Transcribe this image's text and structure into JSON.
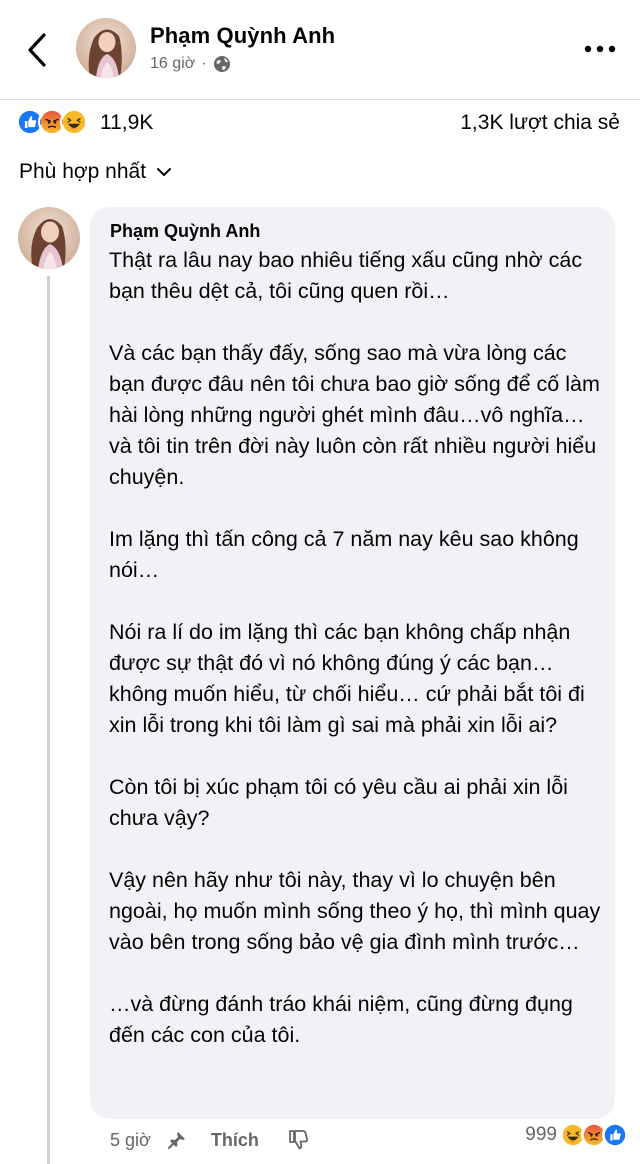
{
  "header": {
    "author": "Phạm Quỳnh Anh",
    "time": "16 giờ",
    "separator": "·",
    "privacy_icon": "globe-icon",
    "back_icon": "chevron-left-icon",
    "more_icon": "more-horizontal-icon"
  },
  "post_stats": {
    "reaction_icons": [
      "like-icon",
      "angry-icon",
      "haha-icon"
    ],
    "reaction_count": "11,9K",
    "share_count": "1,3K lượt chia sẻ"
  },
  "sort": {
    "label": "Phù hợp nhất",
    "icon": "chevron-down-icon"
  },
  "comment": {
    "author": "Phạm Quỳnh Anh",
    "paragraphs": [
      "Thật ra lâu nay bao nhiêu tiếng xấu cũng nhờ các bạn thêu dệt cả, tôi cũng quen rồi…",
      "Và các bạn thấy đấy, sống sao mà vừa lòng các bạn được đâu nên tôi chưa bao giờ sống để cố làm hài lòng những người ghét mình đâu…vô nghĩa… và tôi tin trên đời này luôn còn rất nhiều người hiểu chuyện.",
      "Im lặng thì tấn công cả 7 năm nay kêu sao không nói…",
      "Nói ra lí do im lặng thì các bạn không chấp nhận được sự thật đó vì nó không đúng ý các bạn… không muốn hiểu, từ chối hiểu… cứ phải bắt tôi đi xin lỗi trong khi tôi làm gì sai mà phải xin lỗi ai?",
      "Còn tôi bị xúc phạm tôi có yêu cầu ai phải xin lỗi chưa vậy?",
      "Vậy nên hãy như tôi này, thay vì lo chuyện bên ngoài, họ muốn mình sống theo ý họ, thì mình quay vào bên trong sống bảo vệ gia đình mình trước…",
      "…và đừng đánh tráo khái niệm, cũng đừng đụng đến các con của tôi."
    ],
    "time": "5 giờ",
    "like_label": "Thích",
    "reaction_count": "999",
    "reaction_icons": [
      "haha-icon",
      "angry-icon",
      "like-icon"
    ]
  },
  "colors": {
    "primary_text": "#050505",
    "secondary_text": "#65676b",
    "bubble_bg": "#f0f2f5",
    "like_blue": "#1877f2",
    "angry_orange": "#f0703a",
    "haha_yellow": "#f7b928"
  }
}
